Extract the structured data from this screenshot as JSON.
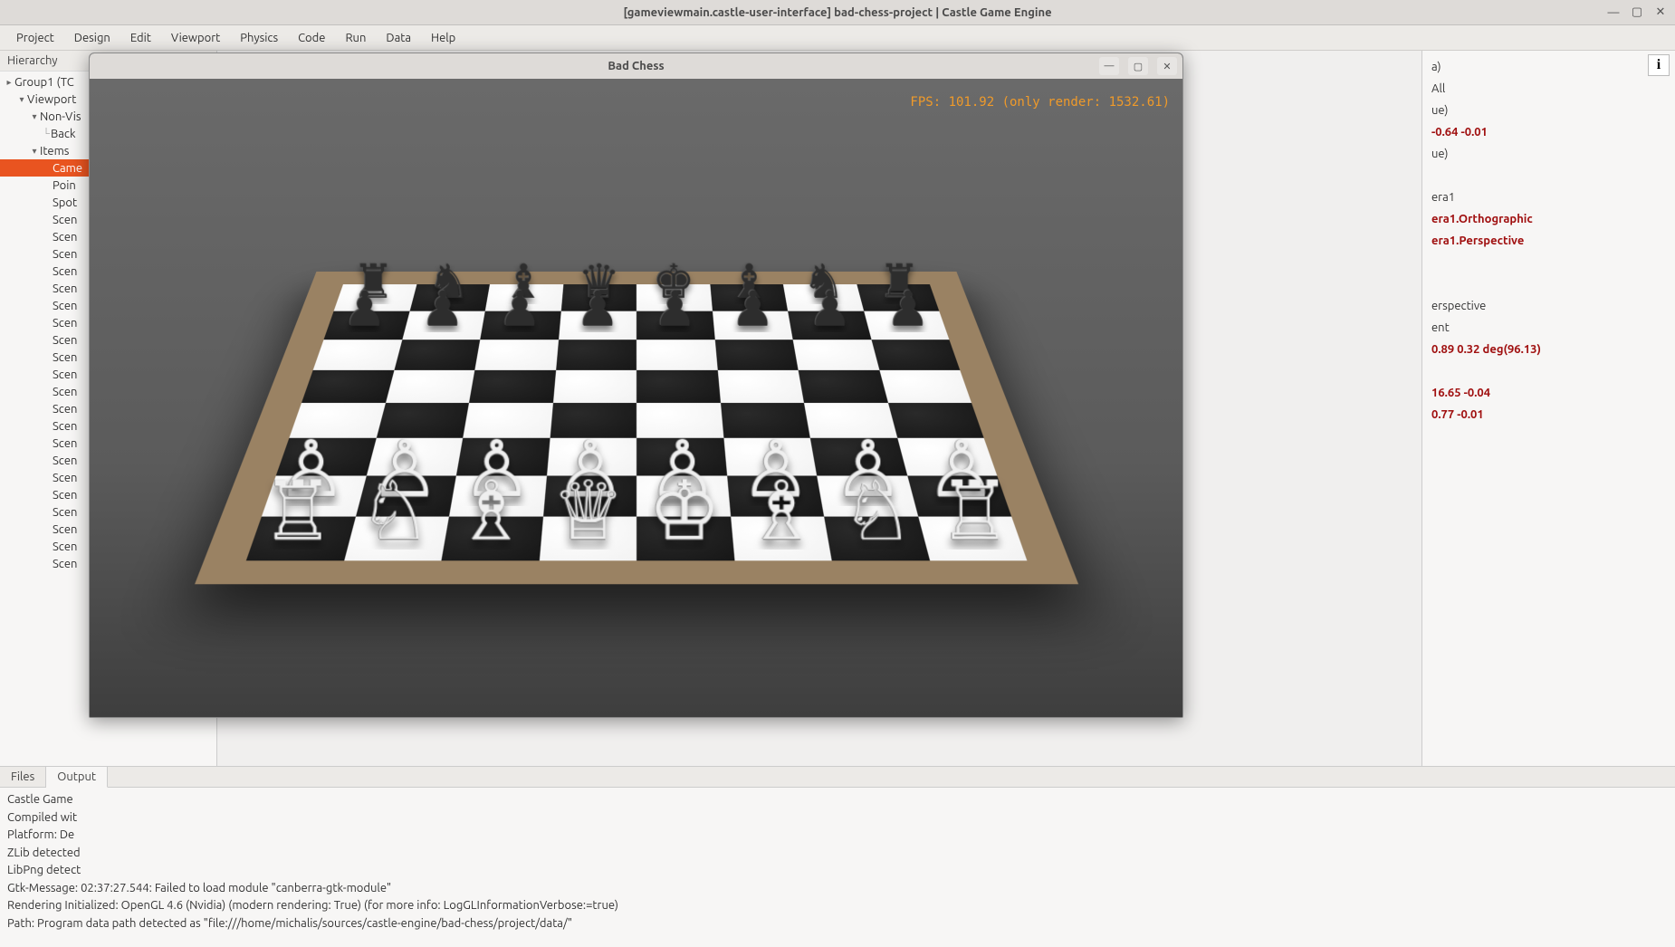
{
  "main_title": "[gameviewmain.castle-user-interface] bad-chess-project | Castle Game Engine",
  "menu": [
    "Project",
    "Design",
    "Edit",
    "Viewport",
    "Physics",
    "Code",
    "Run",
    "Data",
    "Help"
  ],
  "hierarchy_header": "Hierarchy",
  "hierarchy": [
    {
      "indent": 0,
      "exp": "▸",
      "label": "Group1  (TC"
    },
    {
      "indent": 1,
      "exp": "▾",
      "label": "Viewport"
    },
    {
      "indent": 2,
      "exp": "▾",
      "label": "Non-Vis"
    },
    {
      "indent": 3,
      "exp": "└",
      "label": "Back"
    },
    {
      "indent": 2,
      "exp": "▾",
      "label": "Items"
    },
    {
      "indent": 3,
      "exp": "",
      "label": "Came",
      "selected": true
    },
    {
      "indent": 3,
      "exp": "",
      "label": "Poin"
    },
    {
      "indent": 3,
      "exp": "",
      "label": "Spot"
    },
    {
      "indent": 3,
      "exp": "",
      "label": "Scen"
    },
    {
      "indent": 3,
      "exp": "",
      "label": "Scen"
    },
    {
      "indent": 3,
      "exp": "",
      "label": "Scen"
    },
    {
      "indent": 3,
      "exp": "",
      "label": "Scen"
    },
    {
      "indent": 3,
      "exp": "",
      "label": "Scen"
    },
    {
      "indent": 3,
      "exp": "",
      "label": "Scen"
    },
    {
      "indent": 3,
      "exp": "",
      "label": "Scen"
    },
    {
      "indent": 3,
      "exp": "",
      "label": "Scen"
    },
    {
      "indent": 3,
      "exp": "",
      "label": "Scen"
    },
    {
      "indent": 3,
      "exp": "",
      "label": "Scen"
    },
    {
      "indent": 3,
      "exp": "",
      "label": "Scen"
    },
    {
      "indent": 3,
      "exp": "",
      "label": "Scen"
    },
    {
      "indent": 3,
      "exp": "",
      "label": "Scen"
    },
    {
      "indent": 3,
      "exp": "",
      "label": "Scen"
    },
    {
      "indent": 3,
      "exp": "",
      "label": "Scen"
    },
    {
      "indent": 3,
      "exp": "",
      "label": "Scen"
    },
    {
      "indent": 3,
      "exp": "",
      "label": "Scen"
    },
    {
      "indent": 3,
      "exp": "",
      "label": "Scen"
    },
    {
      "indent": 3,
      "exp": "",
      "label": "Scen"
    },
    {
      "indent": 3,
      "exp": "",
      "label": "Scen"
    },
    {
      "indent": 3,
      "exp": "",
      "label": "Scen"
    }
  ],
  "tabs": {
    "files": "Files",
    "output": "Output"
  },
  "output_lines": [
    "Castle Game ",
    "Compiled wit",
    "Platform: De",
    "ZLib detected",
    "LibPng detect",
    "Gtk-Message: 02:37:27.544: Failed to load module \"canberra-gtk-module\"",
    "Rendering Initialized: OpenGL 4.6 (Nvidia) (modern rendering: True) (for more info: LogGLInformationVerbose:=true)",
    "Path: Program data path detected as \"file:///home/michalis/sources/castle-engine/bad-chess/project/data/\""
  ],
  "properties": [
    {
      "text": "a)",
      "cls": ""
    },
    {
      "text": "All",
      "cls": ""
    },
    {
      "text": "ue)",
      "cls": ""
    },
    {
      "text": "-0.64 -0.01",
      "cls": "bold-red"
    },
    {
      "text": "ue)",
      "cls": ""
    },
    {
      "text": "",
      "cls": ""
    },
    {
      "text": "era1",
      "cls": ""
    },
    {
      "text": "era1.Orthographic",
      "cls": "sub"
    },
    {
      "text": "era1.Perspective",
      "cls": "sub"
    },
    {
      "text": "",
      "cls": ""
    },
    {
      "text": "",
      "cls": ""
    },
    {
      "text": "erspective",
      "cls": ""
    },
    {
      "text": "ent",
      "cls": ""
    },
    {
      "text": "0.89 0.32 deg(96.13)",
      "cls": "bold-red"
    },
    {
      "text": "",
      "cls": ""
    },
    {
      "text": "16.65 -0.04",
      "cls": "bold-red"
    },
    {
      "text": "0.77 -0.01",
      "cls": "bold-red"
    }
  ],
  "info_btn": "i",
  "game_window": {
    "title": "Bad Chess",
    "fps": "FPS: 101.92 (only render: 1532.61)"
  },
  "chess_setup": {
    "black_front_rank": [
      "♟",
      "♟",
      "♟",
      "♟",
      "♟",
      "♟",
      "♟",
      "♟"
    ],
    "black_back_rank": [
      "♜",
      "♞",
      "♝",
      "♛",
      "♚",
      "♝",
      "♞",
      "♜"
    ],
    "white_front_rank": [
      "♙",
      "♙",
      "♙",
      "♙",
      "♙",
      "♙",
      "♙",
      "♙"
    ],
    "white_back_rank": [
      "♖",
      "♘",
      "♗",
      "♕",
      "♔",
      "♗",
      "♘",
      "♖"
    ]
  }
}
